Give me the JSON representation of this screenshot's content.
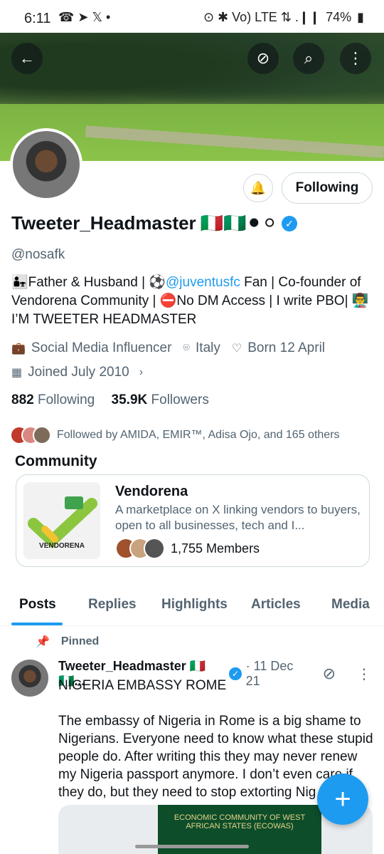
{
  "status_bar": {
    "time": "6:11",
    "left_icons": "☎ ➤ 𝕏 •",
    "battery": "74%",
    "right_icons": "⊙ ✱ Vo) LTE ⇅ .❙❙ "
  },
  "header": {
    "back_icon": "←",
    "grok_icon": "⊘",
    "search_icon": "⌕",
    "more_icon": "⋮"
  },
  "profile": {
    "name": "Tweeter_Headmaster",
    "name_emojis": "🇮🇹🇳🇬⚫⚪",
    "handle": "@nosafk",
    "bio_part1": "👨‍👧Father & Husband | ⚽",
    "bio_link": "@juventusfc",
    "bio_part2": " Fan | Co-founder of Vendorena Community | ⛔No DM Access | I write PBO| 👨‍🏫 I’M TWEETER HEADMASTER",
    "category": "Social Media Influencer",
    "location": "Italy",
    "birthday": "Born 12 April",
    "joined": "Joined July 2010",
    "following_count": "882",
    "following_label": "Following",
    "followers_count": "35.9K",
    "followers_label": "Followers",
    "followed_by": "Followed by AMIDA, EMIR™, Adisa Ojo, and 165 others"
  },
  "buttons": {
    "following": "Following"
  },
  "community": {
    "section_title": "Community",
    "name": "Vendorena",
    "description": "A marketplace on X linking vendors to buyers, open to all businesses, tech and I...",
    "members": "1,755 Members",
    "logo_text": "VENDORENA"
  },
  "tabs": [
    "Posts",
    "Replies",
    "Highlights",
    "Articles",
    "Media"
  ],
  "post": {
    "pinned_label": "Pinned",
    "author": "Tweeter_Headmaster 🇮🇹🇳🇬...",
    "date": "· 11 Dec 21",
    "text": "NIGERIA EMBASSY ROME\n\nThe embassy of Nigeria in Rome is a big shame to Nigerians. Everyone need to know what these stupid people do. After writing this they may never renew my Nigeria passport anymore. I don’t even care if they do, but they need to stop extorting Nig",
    "media_text": "ECONOMIC COMMUNITY OF WEST AFRICAN STATES (ECOWAS)"
  },
  "fab_icon": "+"
}
